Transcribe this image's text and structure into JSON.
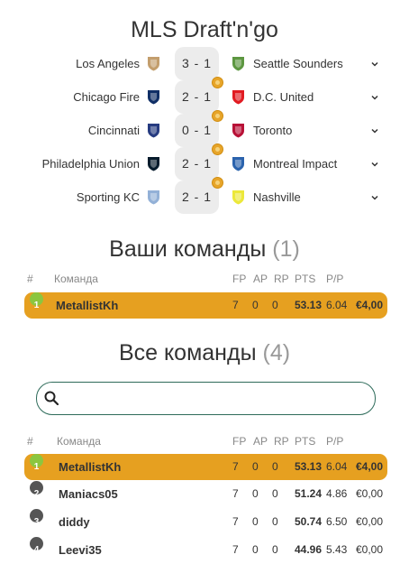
{
  "title": "MLS Draft'n'go",
  "matches": [
    {
      "home": "Los Angeles",
      "score": "3 - 1",
      "away": "Seattle Sounders",
      "medal": false,
      "home_color": "#c39e6d",
      "away_color": "#5d9741"
    },
    {
      "home": "Chicago Fire",
      "score": "2 - 1",
      "away": "D.C. United",
      "medal": true,
      "home_color": "#102f66",
      "away_color": "#e11b22"
    },
    {
      "home": "Cincinnati",
      "score": "0 - 1",
      "away": "Toronto",
      "medal": true,
      "home_color": "#263b80",
      "away_color": "#b81137"
    },
    {
      "home": "Philadelphia Union",
      "score": "2 - 1",
      "away": "Montreal Impact",
      "medal": true,
      "home_color": "#071b2c",
      "away_color": "#2b63ad"
    },
    {
      "home": "Sporting KC",
      "score": "2 - 1",
      "away": "Nashville",
      "medal": true,
      "home_color": "#93b1d7",
      "away_color": "#ece83a"
    }
  ],
  "your_teams": {
    "heading": "Ваши команды",
    "count": "(1)"
  },
  "all_teams": {
    "heading": "Все команды",
    "count": "(4)"
  },
  "table_headers": {
    "num": "#",
    "team": "Команда",
    "fp": "FP",
    "ap": "AP",
    "rp": "RP",
    "pts": "PTS",
    "pp": "P/P"
  },
  "search": {
    "placeholder": ""
  },
  "your_rows": [
    {
      "rank": "1",
      "name": "MetallistKh",
      "fp": "7",
      "ap": "0",
      "rp": "0",
      "pts": "53.13",
      "pp": "6.04",
      "prize": "€4,00"
    }
  ],
  "all_rows": [
    {
      "rank": "1",
      "name": "MetallistKh",
      "fp": "7",
      "ap": "0",
      "rp": "0",
      "pts": "53.13",
      "pp": "6.04",
      "prize": "€4,00"
    },
    {
      "rank": "2",
      "name": "Maniacs05",
      "fp": "7",
      "ap": "0",
      "rp": "0",
      "pts": "51.24",
      "pp": "4.86",
      "prize": "€0,00"
    },
    {
      "rank": "3",
      "name": "diddy",
      "fp": "7",
      "ap": "0",
      "rp": "0",
      "pts": "50.74",
      "pp": "6.50",
      "prize": "€0,00"
    },
    {
      "rank": "4",
      "name": "Leevi35",
      "fp": "7",
      "ap": "0",
      "rp": "0",
      "pts": "44.96",
      "pp": "5.43",
      "prize": "€0,00"
    }
  ],
  "colors": {
    "highlight": "#e6a020",
    "rank_first": "#8cc63f",
    "rank_other": "#555555",
    "search_border": "#2e6b5a"
  }
}
